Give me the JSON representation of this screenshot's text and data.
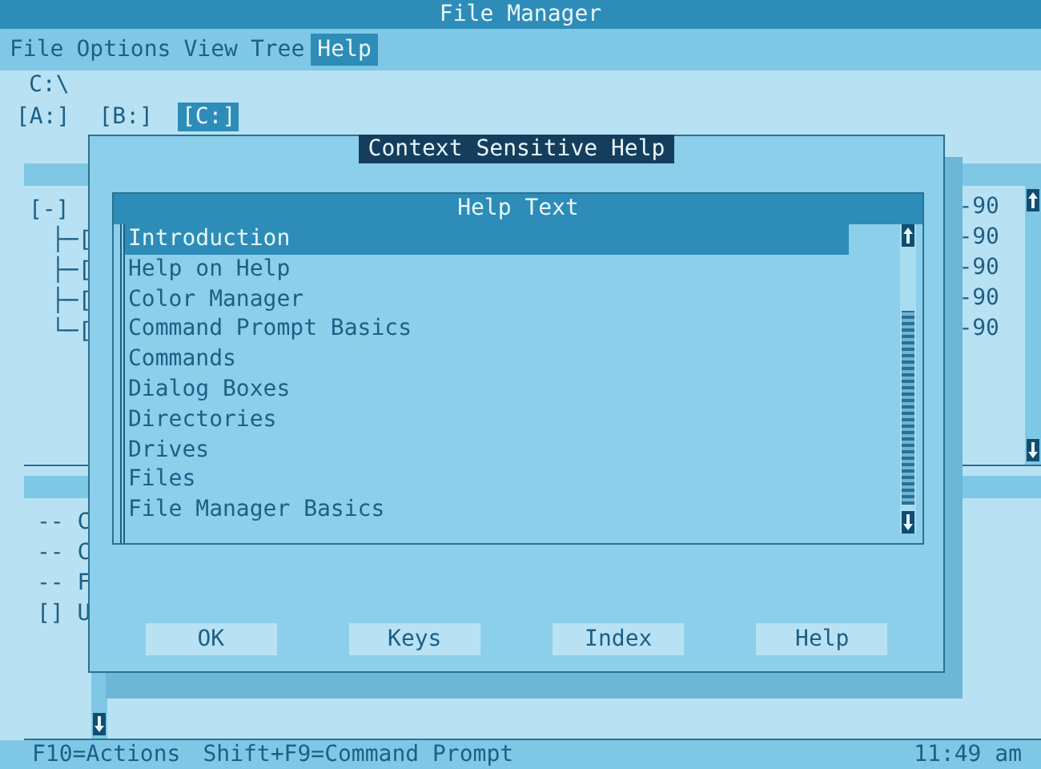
{
  "window": {
    "title": "File Manager"
  },
  "menu": [
    {
      "label": "File",
      "selected": false
    },
    {
      "label": "Options",
      "selected": false
    },
    {
      "label": "View",
      "selected": false
    },
    {
      "label": "Tree",
      "selected": false
    },
    {
      "label": "Help",
      "selected": true
    }
  ],
  "path": "C:\\",
  "drives": [
    {
      "label": "[A:]",
      "selected": false
    },
    {
      "label": "[B:]",
      "selected": false
    },
    {
      "label": "[C:]",
      "selected": true
    }
  ],
  "tree": {
    "label": "[-]",
    "children": [
      {
        "label": "├─["
      },
      {
        "label": "├─["
      },
      {
        "label": "├─["
      },
      {
        "label": "└─["
      }
    ]
  },
  "right_column": [
    "-90",
    "-90",
    "-90",
    "-90",
    "-90"
  ],
  "file_list": [
    "-- C",
    "-- C",
    "-- F",
    "[] U"
  ],
  "dialog": {
    "title": "Context Sensitive Help",
    "list_title": "Help Text",
    "items": [
      {
        "label": "Introduction",
        "selected": true
      },
      {
        "label": "Help on Help",
        "selected": false
      },
      {
        "label": "Color Manager",
        "selected": false
      },
      {
        "label": "Command Prompt Basics",
        "selected": false
      },
      {
        "label": "Commands",
        "selected": false
      },
      {
        "label": "Dialog Boxes",
        "selected": false
      },
      {
        "label": "Directories",
        "selected": false
      },
      {
        "label": "Drives",
        "selected": false
      },
      {
        "label": "Files",
        "selected": false
      },
      {
        "label": "File Manager Basics",
        "selected": false
      }
    ],
    "buttons": [
      "OK",
      "Keys",
      "Index",
      "Help"
    ]
  },
  "status_bar": {
    "items": [
      "F10=Actions",
      "Shift+F9=Command Prompt"
    ],
    "time": "11:49 am"
  }
}
